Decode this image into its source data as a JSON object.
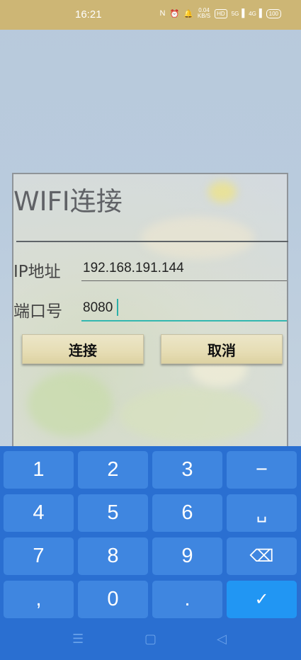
{
  "status_bar": {
    "time": "16:21",
    "icons": [
      "nfc-icon",
      "alarm-icon",
      "bell-icon"
    ],
    "net_speed_value": "0.04",
    "net_speed_unit": "KB/S",
    "hd_label": "HD",
    "signal1": "5G",
    "signal2": "4G",
    "battery": "100"
  },
  "dialog": {
    "title": "WIFI连接",
    "ip_label": "IP地址",
    "ip_value": "192.168.191.144",
    "port_label": "端口号",
    "port_value": "8080",
    "connect_label": "连接",
    "cancel_label": "取消"
  },
  "keyboard": {
    "keys": [
      "1",
      "2",
      "3",
      "−",
      "4",
      "5",
      "6",
      "␣",
      "7",
      "8",
      "9",
      "⌫",
      ",",
      "0",
      ".",
      "✓"
    ]
  },
  "nav": {
    "menu": "☰",
    "home": "▢",
    "back": "◁"
  }
}
